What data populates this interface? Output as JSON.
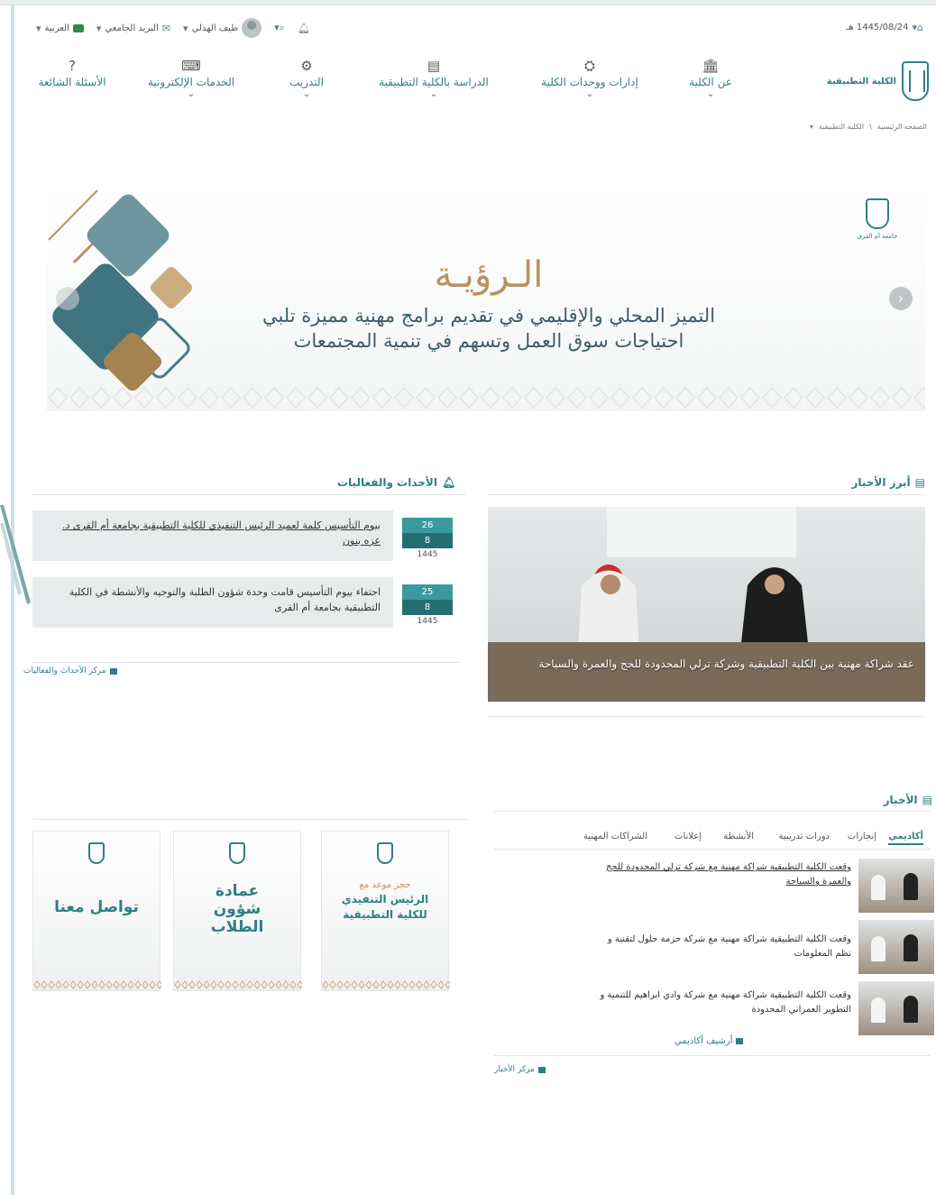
{
  "topbar": {
    "date": "1445/08/24 هـ",
    "home_icon": "home-icon",
    "notifications_icon": "bell-icon",
    "search_icon": "search-icon",
    "user_name": "طيف الهذلي",
    "mail_label": "البريد الجامعي",
    "language_label": "العربية"
  },
  "logo": {
    "text": "الكلية التطبيقية"
  },
  "breadcrumb": {
    "home": "الصفحة الرئيسية",
    "current": "الكلية التطبيقية"
  },
  "nav": {
    "items": [
      {
        "label": "عن الكلية",
        "icon": "institution-icon"
      },
      {
        "label": "إدارات ووحدات الكلية",
        "icon": "admin-units-icon"
      },
      {
        "label": "الدراسة بالكلية التطبيقية",
        "icon": "study-icon"
      },
      {
        "label": "التدريب",
        "icon": "training-icon"
      },
      {
        "label": "الخدمات الإلكترونية",
        "icon": "keyboard-icon"
      },
      {
        "label": "الأسئلة الشائعة",
        "icon": "question-icon"
      }
    ]
  },
  "hero": {
    "title": "الـرؤيـة",
    "line1": "التميز المحلي والإقليمي في تقديم برامج مهنية مميزة تلبي",
    "line2": "احتياجات سوق العمل وتسهم في تنمية المجتمعات",
    "logo_text": "جامعة أم القرى"
  },
  "top_news": {
    "title": "أبرز الأخبار",
    "caption": "عقد شراكة مهنية بين الكلية التطبيقية وشركة ترلي المحدودة للحج والعمرة والسياحة"
  },
  "events": {
    "title": "الأحداث والفعاليات",
    "items": [
      {
        "day": "26",
        "month": "8",
        "year": "1445",
        "text": "بيوم التأسيس كلمة لعميد الرئيس التنفيذي للكلية التطبيقية بجامعة أم القرى د. عزه بنون"
      },
      {
        "day": "25",
        "month": "8",
        "year": "1445",
        "text": "احتفاء بيوم التأسيس قامت وحدة شؤون الطلبة والتوجيه والأنشطة في الكلية التطبيقية بجامعة أم القرى"
      }
    ],
    "center_link": "مركز الأحداث والفعاليات"
  },
  "cards": [
    {
      "subtitle": "حجز موعد مع",
      "title": "الرئيس التنفيذي للكلية التطبيقية"
    },
    {
      "title": "عمادة شؤون الطلاب"
    },
    {
      "title": "تواصل معنا"
    }
  ],
  "news": {
    "title": "الأخبار",
    "tabs": [
      "أكاديمي",
      "إنجازات",
      "دورات تدريبية",
      "الأنشطة",
      "إعلانات",
      "الشراكات المهنية"
    ],
    "items": [
      {
        "text": "وقعت الكلية التطبيقية شراكة مهنية مع شركة ترلي المحدودة للحج والعمرة والسياحة"
      },
      {
        "text": "وقعت الكلية التطبيقية شراكة مهنية مع شركة حزمة حلول لتقنية و نظم المعلومات"
      },
      {
        "text": "وقعت الكلية التطبيقية شراكة مهنية مع شركة وادي ابراهيم للتنمية و التطوير العمراني المحدودة"
      }
    ],
    "archive_link": "أرشيف أكاديمي",
    "center_link": "مركز الأخبار"
  }
}
